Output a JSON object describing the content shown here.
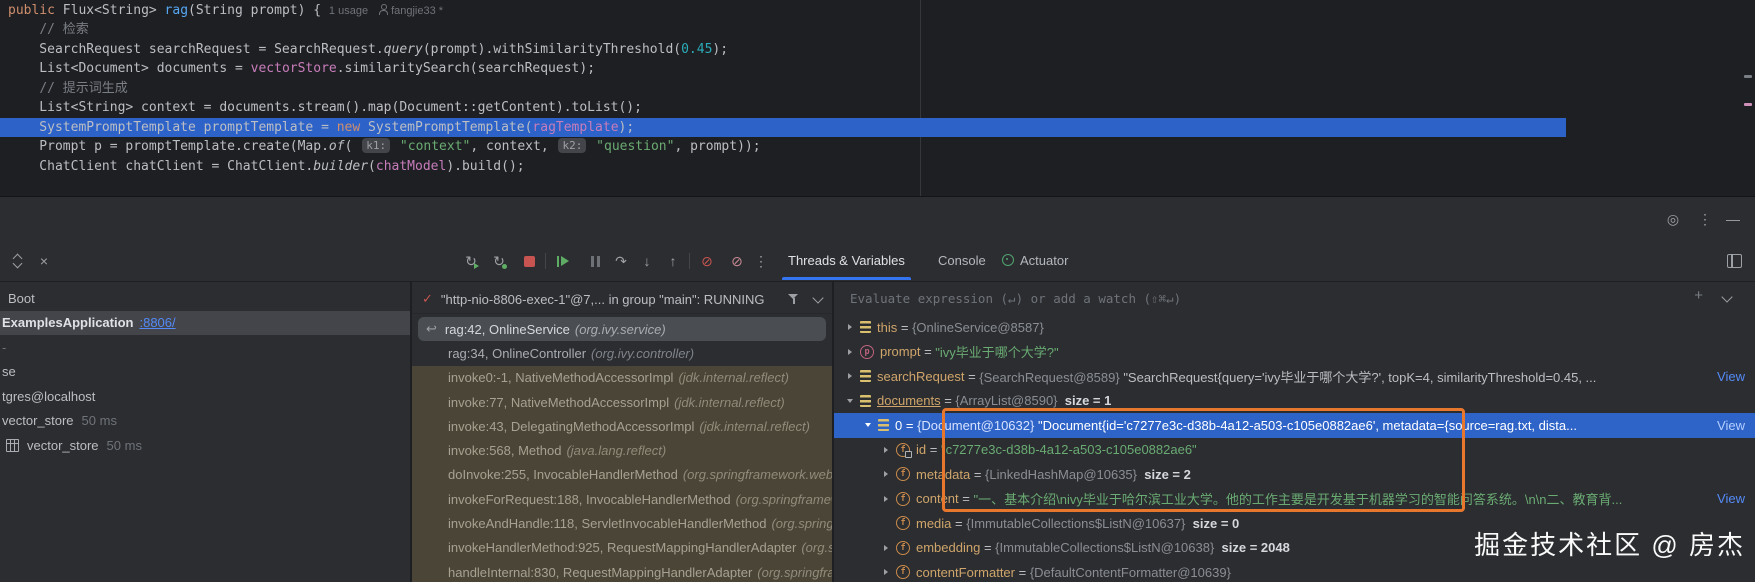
{
  "palette": {
    "editor_bg": "#1E1F22",
    "panel_bg": "#2B2D30",
    "execution_line_blue": "#2D63C9",
    "selection_blue": "#2E63C8",
    "active_tab_accent": "#3574F0",
    "annotation_orange": "#E8772E",
    "link_blue": "#548AF7",
    "library_frame_olive": "#4B4537",
    "string_green": "#6AAB73",
    "keyword_orange": "#CF8E6D",
    "field_purple": "#C77DBB"
  },
  "editor": {
    "lines": [
      {
        "segs": [
          {
            "t": "public ",
            "c": "kw"
          },
          {
            "t": "Flux<String> ",
            "c": "pl"
          },
          {
            "t": "rag",
            "c": "mth"
          },
          {
            "t": "(String prompt) { ",
            "c": "pl"
          },
          {
            "t": "1 usage",
            "c": "inlay"
          },
          {
            "t": "",
            "c": "author-icon"
          },
          {
            "t": "fangjie33 *",
            "c": "inlay"
          }
        ]
      },
      {
        "segs": [
          {
            "t": "    ",
            "c": "pl"
          },
          {
            "t": "// 检索",
            "c": "cmt"
          }
        ]
      },
      {
        "segs": [
          {
            "t": "    SearchRequest searchRequest = SearchRequest.",
            "c": "pl"
          },
          {
            "t": "query",
            "c": "it"
          },
          {
            "t": "(prompt).withSimilarityThreshold(",
            "c": "pl"
          },
          {
            "t": "0.45",
            "c": "num"
          },
          {
            "t": ");",
            "c": "pl"
          }
        ]
      },
      {
        "segs": [
          {
            "t": "    List<Document> documents = ",
            "c": "pl"
          },
          {
            "t": "vectorStore",
            "c": "fld"
          },
          {
            "t": ".similaritySearch(searchRequest);",
            "c": "pl"
          }
        ]
      },
      {
        "segs": [
          {
            "t": "    ",
            "c": "pl"
          },
          {
            "t": "// 提示词生成",
            "c": "cmt"
          }
        ]
      },
      {
        "segs": [
          {
            "t": "    List<String> context = documents.stream().map(Document::getContent).toList();",
            "c": "pl"
          }
        ]
      },
      {
        "exec": true,
        "segs": [
          {
            "t": "    SystemPromptTemplate promptTemplate = ",
            "c": "pl"
          },
          {
            "t": "new ",
            "c": "kw"
          },
          {
            "t": "SystemPromptTemplate(",
            "c": "pl"
          },
          {
            "t": "ragTemplate",
            "c": "fld"
          },
          {
            "t": ");",
            "c": "pl"
          }
        ]
      },
      {
        "segs": [
          {
            "t": "    Prompt p = promptTemplate.create(Map.",
            "c": "pl"
          },
          {
            "t": "of",
            "c": "it"
          },
          {
            "t": "( ",
            "c": "pl"
          },
          {
            "t": "k1:",
            "c": "chip"
          },
          {
            "t": " ",
            "c": "pl"
          },
          {
            "t": "\"context\"",
            "c": "str"
          },
          {
            "t": ", context, ",
            "c": "pl"
          },
          {
            "t": "k2:",
            "c": "chip"
          },
          {
            "t": " ",
            "c": "pl"
          },
          {
            "t": "\"question\"",
            "c": "str"
          },
          {
            "t": ", prompt));",
            "c": "pl"
          }
        ]
      },
      {
        "segs": [
          {
            "t": "    ChatClient chatClient = ChatClient.",
            "c": "pl"
          },
          {
            "t": "builder",
            "c": "it"
          },
          {
            "t": "(",
            "c": "pl"
          },
          {
            "t": "chatModel",
            "c": "fld"
          },
          {
            "t": ").build();",
            "c": "pl"
          }
        ]
      }
    ]
  },
  "toolbar": {
    "tabs": [
      {
        "label": "Threads & Variables",
        "active": true
      },
      {
        "label": "Console"
      },
      {
        "label": "Actuator"
      }
    ]
  },
  "services": {
    "rows": [
      {
        "label": "Boot",
        "indent": 8
      },
      {
        "label": "ExamplesApplication",
        "link": ":8806/",
        "selected": true,
        "bold": true
      },
      {
        "label": "-",
        "dim": true
      },
      {
        "label": "se"
      },
      {
        "label": "tgres@localhost"
      },
      {
        "label": "vector_store",
        "time": "50 ms"
      },
      {
        "label": "vector_store",
        "time": "50 ms",
        "icon": "table"
      }
    ]
  },
  "frames": {
    "thread_label": "\"http-nio-8806-exec-1\"@7,... in group \"main\": RUNNING",
    "rows": [
      {
        "method": "rag:42, OnlineService",
        "pkg": "(org.ivy.service)",
        "selected": true
      },
      {
        "method": "rag:34, OnlineController",
        "pkg": "(org.ivy.controller)"
      },
      {
        "method": "invoke0:-1, NativeMethodAccessorImpl",
        "pkg": "(jdk.internal.reflect)",
        "lib": true
      },
      {
        "method": "invoke:77, NativeMethodAccessorImpl",
        "pkg": "(jdk.internal.reflect)",
        "lib": true
      },
      {
        "method": "invoke:43, DelegatingMethodAccessorImpl",
        "pkg": "(jdk.internal.reflect)",
        "lib": true
      },
      {
        "method": "invoke:568, Method",
        "pkg": "(java.lang.reflect)",
        "lib": true
      },
      {
        "method": "doInvoke:255, InvocableHandlerMethod",
        "pkg": "(org.springframework.web.m",
        "lib": true
      },
      {
        "method": "invokeForRequest:188, InvocableHandlerMethod",
        "pkg": "(org.springframew",
        "lib": true
      },
      {
        "method": "invokeAndHandle:118, ServletInvocableHandlerMethod",
        "pkg": "(org.springfr",
        "lib": true
      },
      {
        "method": "invokeHandlerMethod:925, RequestMappingHandlerAdapter",
        "pkg": "(org.sp",
        "lib": true
      },
      {
        "method": "handleInternal:830, RequestMappingHandlerAdapter",
        "pkg": "(org.springfra",
        "lib": true
      }
    ]
  },
  "variables": {
    "evaluate_placeholder": "Evaluate expression (↵) or add a watch (⇧⌘↵)",
    "rows": [
      {
        "exp": ">",
        "icon": "object",
        "name": "this",
        "v": [
          {
            "t": "{OnlineService@8587}",
            "c": "ref"
          }
        ]
      },
      {
        "exp": ">",
        "icon": "param",
        "name": "prompt",
        "v": [
          {
            "t": "\"ivy毕业于哪个大学?\"",
            "c": "str"
          }
        ]
      },
      {
        "exp": ">",
        "icon": "object",
        "name": "searchRequest",
        "v": [
          {
            "t": "{SearchRequest@8589} ",
            "c": "ref"
          },
          {
            "t": "\"SearchRequest{query='ivy毕业于哪个大学?', topK=4, similarityThreshold=0.45, ...",
            "c": "pl"
          }
        ],
        "link": "View"
      },
      {
        "exp": "v",
        "icon": "object",
        "name": "documents",
        "u": true,
        "v": [
          {
            "t": "{ArrayList@8590}  ",
            "c": "ref"
          },
          {
            "t": "size = 1",
            "c": "size"
          }
        ]
      },
      {
        "exp": "v",
        "icon": "object",
        "name": "0",
        "indent": 1,
        "selected": true,
        "v": [
          {
            "t": "{Document@10632} ",
            "c": "ref"
          },
          {
            "t": "\"Document{id='c7277e3c-d38b-4a12-a503-c105e0882ae6', metadata={source=rag.txt, dista...",
            "c": "pl"
          }
        ],
        "link": "View"
      },
      {
        "exp": ">",
        "icon": "field",
        "lock": true,
        "name": "id",
        "indent": 2,
        "v": [
          {
            "t": "\"c7277e3c-d38b-4a12-a503-c105e0882ae6\"",
            "c": "str"
          }
        ]
      },
      {
        "exp": ">",
        "icon": "field",
        "name": "metadata",
        "indent": 2,
        "v": [
          {
            "t": "{LinkedHashMap@10635}  ",
            "c": "ref"
          },
          {
            "t": "size = 2",
            "c": "size"
          }
        ]
      },
      {
        "exp": ">",
        "icon": "field",
        "name": "content",
        "indent": 2,
        "v": [
          {
            "t": "\"一、基本介绍\\nivy毕业于哈尔滨工业大学。他的工作主要是开发基于机器学习的智能问答系统。\\n\\n二、教育背...",
            "c": "str"
          }
        ],
        "link": "View"
      },
      {
        "exp": "",
        "icon": "field",
        "name": "media",
        "indent": 2,
        "v": [
          {
            "t": "{ImmutableCollections$ListN@10637}  ",
            "c": "ref"
          },
          {
            "t": "size = 0",
            "c": "size"
          }
        ]
      },
      {
        "exp": ">",
        "icon": "field",
        "name": "embedding",
        "indent": 2,
        "v": [
          {
            "t": "{ImmutableCollections$ListN@10638}  ",
            "c": "ref"
          },
          {
            "t": "size = 2048",
            "c": "size"
          }
        ]
      },
      {
        "exp": ">",
        "icon": "field",
        "name": "contentFormatter",
        "indent": 2,
        "v": [
          {
            "t": "{DefaultContentFormatter@10639}",
            "c": "ref"
          }
        ]
      }
    ]
  },
  "watermark": "掘金技术社区 @ 房杰"
}
